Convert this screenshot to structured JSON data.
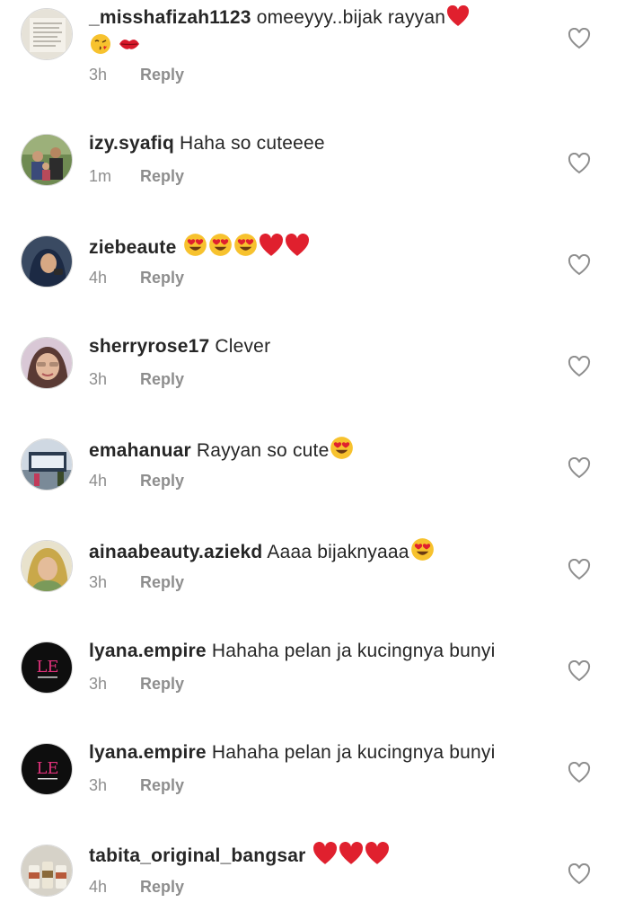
{
  "reply_label": "Reply",
  "comments": [
    {
      "username": "_misshafizah1123",
      "text": "omeeyyy..bijak rayyan",
      "emojis": [
        "red-heart",
        "face-blowing-kiss",
        "kiss-mark"
      ],
      "time": "3h"
    },
    {
      "username": "izy.syafiq",
      "text": "Haha so cuteeee",
      "emojis": [],
      "time": "1m"
    },
    {
      "username": "ziebeaute",
      "text": "",
      "emojis": [
        "heart-eyes",
        "heart-eyes",
        "heart-eyes",
        "red-heart",
        "red-heart"
      ],
      "time": "4h"
    },
    {
      "username": "sherryrose17",
      "text": "Clever",
      "emojis": [],
      "time": "3h"
    },
    {
      "username": "emahanuar",
      "text": "Rayyan so cute",
      "emojis": [
        "heart-eyes"
      ],
      "time": "4h"
    },
    {
      "username": "ainaabeauty.aziekd",
      "text": "Aaaa bijaknyaaa",
      "emojis": [
        "heart-eyes"
      ],
      "time": "3h"
    },
    {
      "username": "lyana.empire",
      "text": "Hahaha pelan ja kucingnya bunyi",
      "emojis": [],
      "time": "3h"
    },
    {
      "username": "lyana.empire",
      "text": "Hahaha pelan ja kucingnya bunyi",
      "emojis": [],
      "time": "3h"
    },
    {
      "username": "tabita_original_bangsar",
      "text": "",
      "emojis": [
        "red-heart",
        "red-heart",
        "red-heart"
      ],
      "time": "4h"
    }
  ],
  "colors": {
    "text": "#262626",
    "meta": "#8e8e8e",
    "heart_red": "#e0202e",
    "emoji_yellow": "#f7c22e"
  }
}
